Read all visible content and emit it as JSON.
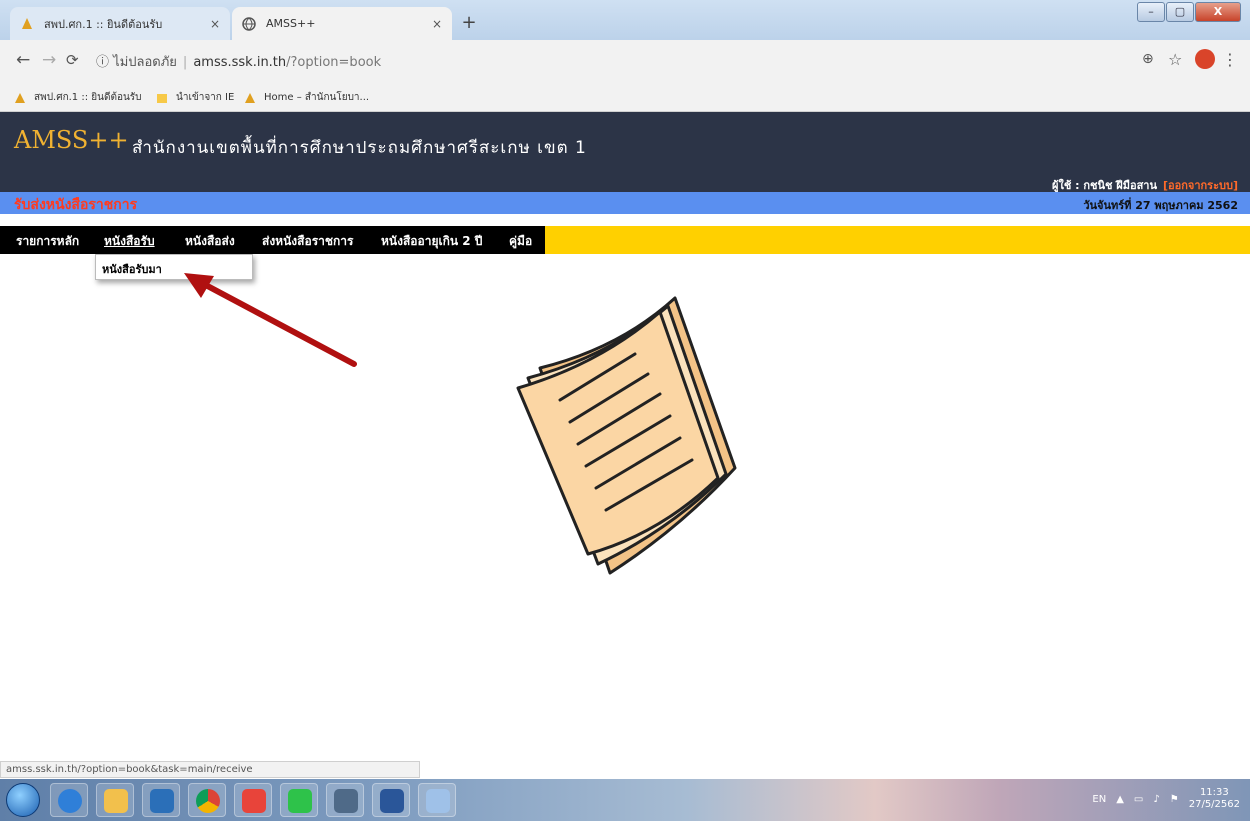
{
  "browser": {
    "tabs": [
      {
        "title": "สพป.ศก.1 :: ยินดีต้อนรับ",
        "active": false
      },
      {
        "title": "AMSS++",
        "active": true
      }
    ],
    "tab_close_glyph": "×",
    "new_tab_glyph": "+",
    "window_controls": {
      "minimize": "–",
      "maximize": "▢",
      "close": "X"
    },
    "security_label": "ไม่ปลอดภัย",
    "url_host": "amss.ssk.in.th",
    "url_path": "/?option=book",
    "bookmarks": [
      {
        "label": "สพป.ศก.1 :: ยินดีต้อนรับ",
        "icon": "site-icon"
      },
      {
        "label": "นำเข้าจาก IE",
        "icon": "folder-icon"
      },
      {
        "label": "Home – สำนักนโยบา...",
        "icon": "site-icon"
      }
    ]
  },
  "page": {
    "brand": "AMSS++",
    "office": "สำนักงานเขตพื้นที่การศึกษาประถมศึกษาศรีสะเกษ เขต 1",
    "user_label": "ผู้ใช้ : กชนิช ฝีมือสาน",
    "logout_label": "[ออกจากระบบ]",
    "section_title": "รับส่งหนังสือราชการ",
    "thai_date": "วันจันทร์ที่ 27 พฤษภาคม 2562",
    "menu": [
      {
        "label": "รายการหลัก",
        "active": false
      },
      {
        "label": "หนังสือรับ",
        "active": true
      },
      {
        "label": "หนังสือส่ง",
        "active": false
      },
      {
        "label": "ส่งหนังสือราชการ",
        "active": false
      },
      {
        "label": "หนังสืออายุเกิน 2 ปี",
        "active": false
      },
      {
        "label": "คู่มือ",
        "active": false
      }
    ],
    "dropdown_items": [
      "หนังสือรับมา"
    ]
  },
  "status_url": "amss.ssk.in.th/?option=book&task=main/receive",
  "taskbar": {
    "apps": [
      "start-icon",
      "ie-icon",
      "explorer-icon",
      "media-icon",
      "chrome-icon",
      "app-icon",
      "line-icon",
      "eye-icon",
      "word-icon",
      "paint-icon"
    ],
    "language": "EN",
    "time": "11:33",
    "date": "27/5/2562"
  },
  "colors": {
    "header_bg": "#2c3447",
    "brand": "#f0b232",
    "band_blue": "#5a8ff0",
    "section_red": "#ff3b1f",
    "menu_yellow": "#ffd000",
    "arrow_red": "#b01010"
  }
}
